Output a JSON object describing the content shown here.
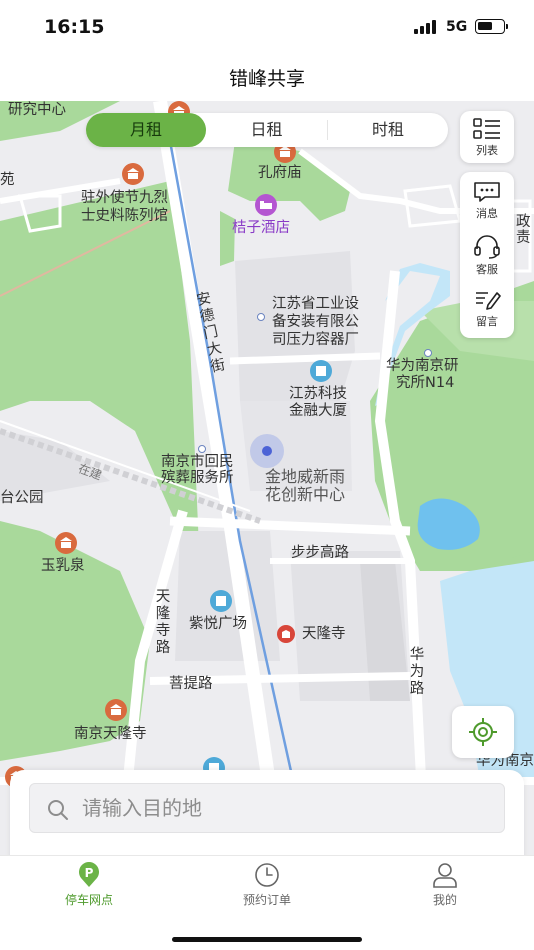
{
  "status_bar": {
    "time": "16:15",
    "network": "5G"
  },
  "header": {
    "title": "错峰共享"
  },
  "rental_tabs": [
    {
      "label": "月租",
      "active": true
    },
    {
      "label": "日租",
      "active": false
    },
    {
      "label": "时租",
      "active": false
    }
  ],
  "side_actions": {
    "list": "列表",
    "message": "消息",
    "service": "客服",
    "feedback": "留言"
  },
  "map": {
    "labels": {
      "research_center": "研究中心",
      "garden": "苑",
      "kongfu_temple": "孔府庙",
      "museum_line1": "驻外使节九烈",
      "museum_line2": "士史料陈列馆",
      "orange_hotel": "桔子酒店",
      "zheng_line1": "政",
      "zheng_line2": "责",
      "jiangsu_ind_line1": "江苏省工业设",
      "jiangsu_ind_line2": "备安装有限公",
      "jiangsu_ind_line3": "司压力容器厂",
      "huawei_inst_line1": "华为南京研",
      "huawei_inst_line2": "究所N14",
      "fintech_line1": "江苏科技",
      "fintech_line2": "金融大厦",
      "funeral_line1": "南京市回民",
      "funeral_line2": "殡葬服务所",
      "jindi_line1": "金地威新雨",
      "jindi_line2": "花创新中心",
      "park": "台公园",
      "yuru_spring": "玉乳泉",
      "bubugao_road": "步步高路",
      "ziyue_plaza": "紫悦广场",
      "tianlong_temple": "天隆寺",
      "puti_road": "菩提路",
      "nanjing_tianlong_temple": "南京天隆寺",
      "huawei_nanjing": "华为南京",
      "andemen_street": "安德门大街",
      "tianlong_temple_road": "天隆寺路",
      "huawei_road": "华为路",
      "railway": "在建"
    }
  },
  "search": {
    "placeholder": "请输入目的地"
  },
  "tab_bar": [
    {
      "label": "停车网点",
      "active": true
    },
    {
      "label": "预约订单",
      "active": false
    },
    {
      "label": "我的",
      "active": false
    }
  ],
  "colors": {
    "accent": "#6bb347",
    "map_green": "#a8d99a",
    "water": "#6fc1ee",
    "road_blue": "#6f9fe0"
  }
}
